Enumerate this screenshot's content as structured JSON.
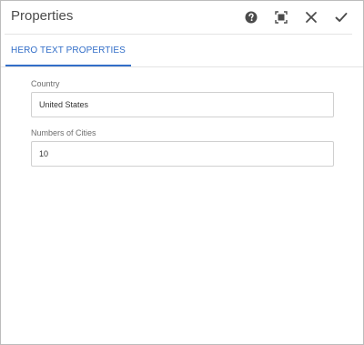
{
  "dialog": {
    "title": "Properties",
    "toolbar": [
      {
        "name": "help-icon",
        "label": "Help"
      },
      {
        "name": "fullscreen-icon",
        "label": "Toggle Fullscreen"
      },
      {
        "name": "close-icon",
        "label": "Cancel"
      },
      {
        "name": "checkmark-icon",
        "label": "Done"
      }
    ]
  },
  "tabs": [
    {
      "label": "HERO TEXT PROPERTIES",
      "active": true
    }
  ],
  "form": {
    "country": {
      "label": "Country",
      "value": "United States"
    },
    "cities": {
      "label": "Numbers of Cities",
      "value": "10"
    }
  },
  "colors": {
    "accent": "#326ec8",
    "icon": "#4b4b4b",
    "background": "#ffffff",
    "border": "#d0d0d0"
  }
}
